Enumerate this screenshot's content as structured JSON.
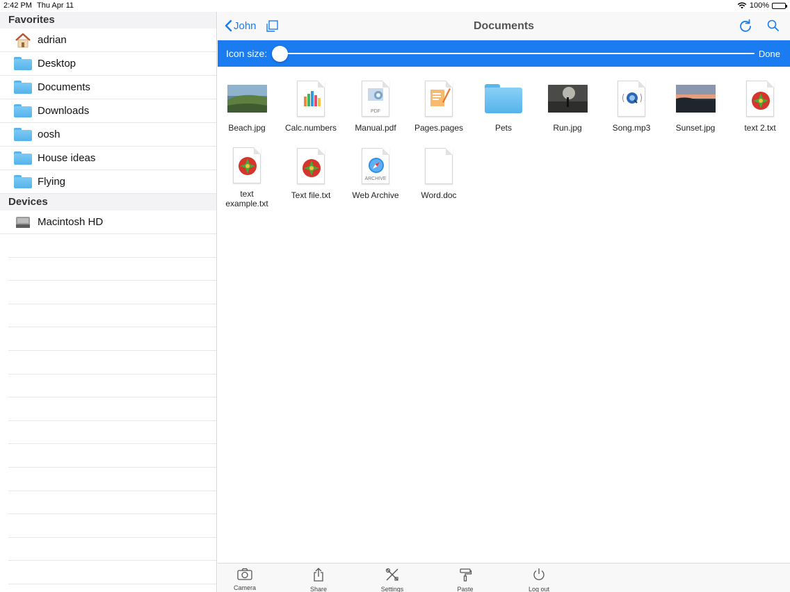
{
  "status_bar": {
    "time": "2:42 PM",
    "date": "Thu Apr 11",
    "battery": "100%"
  },
  "sidebar": {
    "sections": [
      {
        "title": "Favorites",
        "items": [
          {
            "label": "adrian",
            "icon": "home-icon"
          },
          {
            "label": "Desktop",
            "icon": "folder-icon"
          },
          {
            "label": "Documents",
            "icon": "folder-icon"
          },
          {
            "label": "Downloads",
            "icon": "folder-icon"
          },
          {
            "label": "oosh",
            "icon": "folder-icon"
          },
          {
            "label": "House ideas",
            "icon": "folder-icon"
          },
          {
            "label": "Flying",
            "icon": "folder-icon"
          }
        ]
      },
      {
        "title": "Devices",
        "items": [
          {
            "label": "Macintosh HD",
            "icon": "hard-drive-icon"
          }
        ]
      }
    ]
  },
  "navbar": {
    "back_label": "John",
    "title": "Documents"
  },
  "icon_size_bar": {
    "label": "Icon size:",
    "done_label": "Done",
    "value": 0.0
  },
  "files": [
    {
      "name": "Beach.jpg",
      "kind": "photo-beach"
    },
    {
      "name": "Calc.numbers",
      "kind": "numbers"
    },
    {
      "name": "Manual.pdf",
      "kind": "pdf",
      "sub": "PDF"
    },
    {
      "name": "Pages.pages",
      "kind": "pages"
    },
    {
      "name": "Pets",
      "kind": "folder"
    },
    {
      "name": "Run.jpg",
      "kind": "photo-run"
    },
    {
      "name": "Song.mp3",
      "kind": "audio"
    },
    {
      "name": "Sunset.jpg",
      "kind": "photo-sunset"
    },
    {
      "name": "text 2.txt",
      "kind": "text"
    },
    {
      "name": "text example.txt",
      "name_line1": "text",
      "name_line2": "example.txt",
      "kind": "text"
    },
    {
      "name": "Text file.txt",
      "kind": "text"
    },
    {
      "name": "Web Archive",
      "kind": "archive",
      "sub": "ARCHIVE"
    },
    {
      "name": "Word.doc",
      "kind": "blank"
    }
  ],
  "toolbar": {
    "camera": "Camera",
    "share": "Share",
    "settings": "Settings",
    "paste": "Paste",
    "logout": "Log out"
  },
  "colors": {
    "accent": "#1a7cf0",
    "folder": "#5ab5ec"
  }
}
